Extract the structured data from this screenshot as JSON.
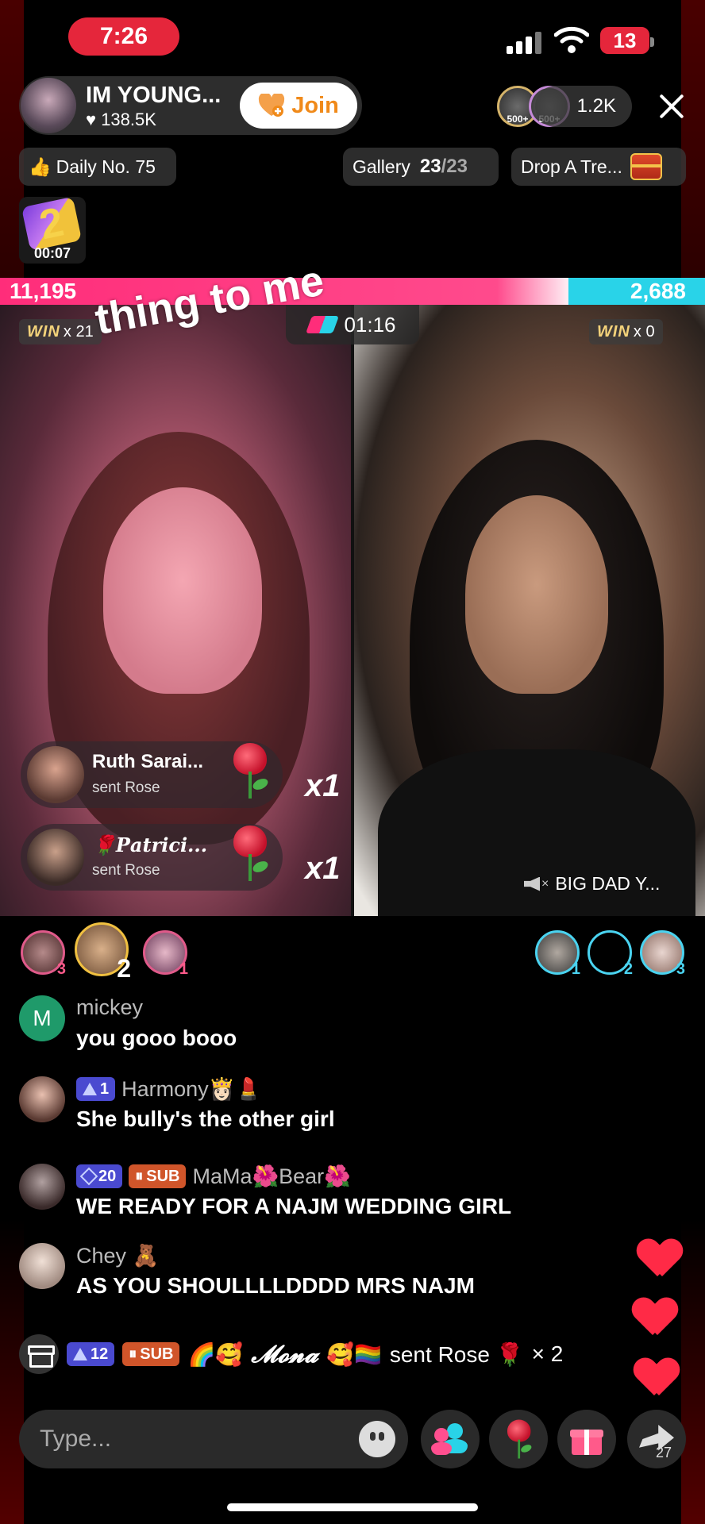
{
  "status_bar": {
    "time": "7:26",
    "battery": "13"
  },
  "host": {
    "name": "IM YOUNG...",
    "likes": "138.5K",
    "join_label": "Join"
  },
  "viewers": {
    "badge_1": "500+",
    "badge_2": "500+",
    "count": "1.2K"
  },
  "tags": {
    "daily": "Daily No. 75",
    "gallery_label": "Gallery",
    "gallery_current": "23",
    "gallery_total": "/23",
    "drop": "Drop A Tre..."
  },
  "game_timer": "00:07",
  "battle": {
    "left_score": "11,195",
    "right_score": "2,688",
    "left_share": 0.806,
    "timer": "01:16",
    "left_win_label": "WIN",
    "left_win_count": "x 21",
    "right_win_label": "WIN",
    "right_win_count": "x 0",
    "caption": "thing to me"
  },
  "gift_popups": [
    {
      "name": "Ruth Sarai...",
      "action": "sent Rose",
      "count": "x1"
    },
    {
      "name": "🌹𝑷𝒂𝒕𝒓𝒊𝒄𝒊...",
      "action": "sent Rose",
      "count": "x1"
    }
  ],
  "opponent_muted_name": "BIG DAD Y...",
  "supporters_left": [
    "3",
    "2",
    "1"
  ],
  "supporters_right": [
    "1",
    "2",
    "3"
  ],
  "chat": [
    {
      "avatar_letter": "M",
      "user": "mickey",
      "message": "you gooo booo"
    },
    {
      "badge_level": "1",
      "user": "Harmony👸🏻💄",
      "message": "She bully's the other girl"
    },
    {
      "badge_level": "20",
      "badge_sub": "SUB",
      "user": "MaMa🌺Bear🌺",
      "message": "WE READY FOR A NAJM WEDDING GIRL"
    },
    {
      "user": "Chey 🧸",
      "message": "AS YOU SHOULLLLDDDD MRS NAJM"
    }
  ],
  "gift_line": {
    "badge_level": "12",
    "badge_sub": "SUB",
    "prefix_emoji": "🌈🥰",
    "user": "𝓜𝓸𝓷𝓪",
    "suffix_emoji": "🥰🏳️‍🌈",
    "action": "sent Rose 🌹",
    "count": "× 2"
  },
  "input": {
    "placeholder": "Type..."
  },
  "share_count": "27",
  "colors": {
    "accent_red": "#e5263b",
    "left_team": "#ff2d7a",
    "right_team": "#29d3e8",
    "join_orange": "#f08a1a"
  }
}
